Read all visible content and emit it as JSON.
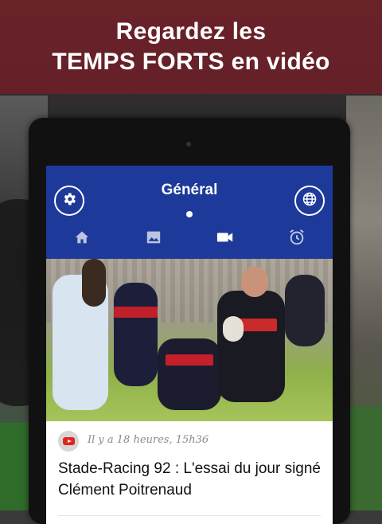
{
  "promo": {
    "line1": "Regardez les",
    "line2": "TEMPS FORTS en vidéo",
    "banner_color": "#6e1e28"
  },
  "app": {
    "header_color": "#1d3a9a",
    "title": "Général",
    "left_button_icon": "gear-icon",
    "right_button_icon": "globe-icon",
    "tabs": [
      {
        "icon": "home-icon"
      },
      {
        "icon": "image-icon"
      },
      {
        "icon": "video-camera-icon",
        "active": true
      },
      {
        "icon": "alarm-clock-icon"
      }
    ]
  },
  "article": {
    "source_icon": "youtube-icon",
    "timestamp": "Il y a 18 heures, 15h36",
    "headline": "Stade-Racing 92 : L'essai du jour signé Clément Poitrenaud"
  }
}
